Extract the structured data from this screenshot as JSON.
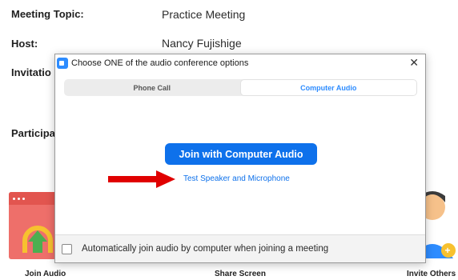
{
  "meeting": {
    "topic_label": "Meeting Topic:",
    "topic_value": "Practice Meeting",
    "host_label": "Host:",
    "host_value": "Nancy Fujishige",
    "invitation_label": "Invitatio",
    "participants_label": "Participa"
  },
  "bottom_bar": {
    "join_audio": "Join Audio",
    "share_screen": "Share Screen",
    "invite_others": "Invite Others"
  },
  "dialog": {
    "title": "Choose ONE of the audio conference options",
    "tabs": [
      {
        "label": "Phone Call",
        "active": false
      },
      {
        "label": "Computer Audio",
        "active": true
      }
    ],
    "primary_button": "Join with Computer Audio",
    "test_link": "Test Speaker and Microphone",
    "auto_join_label": "Automatically join audio by computer when joining a meeting"
  },
  "colors": {
    "accent": "#0e71eb",
    "arrow": "#e00000",
    "join_tile": "#ee6f6a"
  },
  "icons": [
    "zoom-icon",
    "close-icon",
    "headphone-icon",
    "arrow-up-icon",
    "person-icon",
    "plus-icon"
  ]
}
